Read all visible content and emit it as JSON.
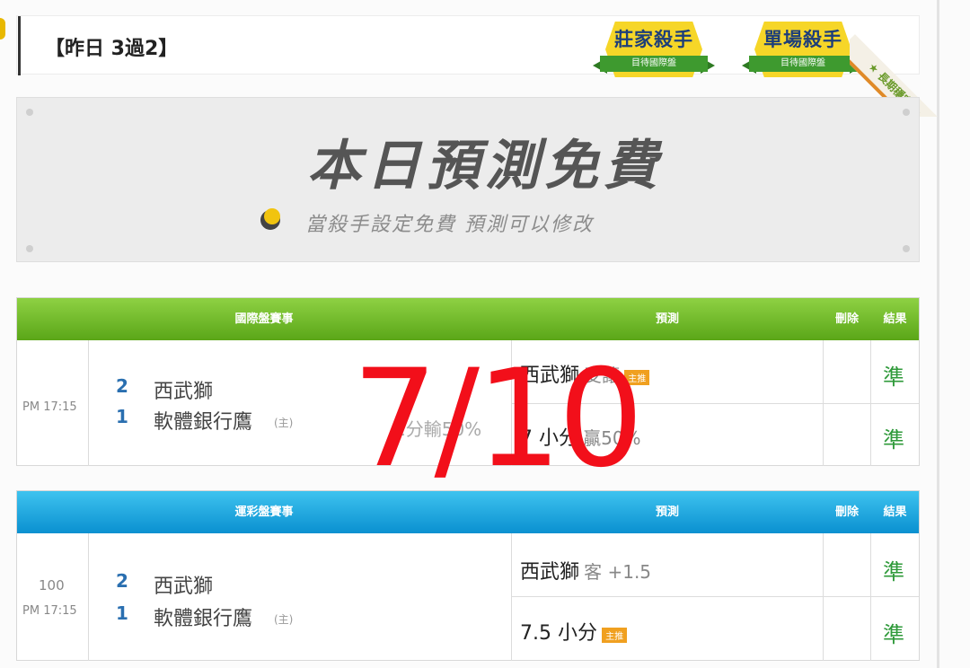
{
  "header": {
    "title": "【昨日 3過2】"
  },
  "badges": [
    {
      "title": "莊家殺手",
      "ribbon": "目待國際盤"
    },
    {
      "title": "單場殺手",
      "ribbon": "目待國際盤"
    }
  ],
  "corner_label": "★ 長期穩定 ★",
  "promo": {
    "title": "本日預測免費",
    "subtitle": "當殺手設定免費  預測可以修改"
  },
  "intl_table": {
    "headers": {
      "event": "國際盤賽事",
      "predict": "預測",
      "delete": "刪除",
      "result": "結果"
    },
    "time": "PM 17:15",
    "team1": {
      "score": "2",
      "name": "西武獅"
    },
    "team2": {
      "score": "1",
      "name": "軟體銀行鷹",
      "mark": "(主)"
    },
    "line_info": "1分輸50%",
    "pred1": {
      "main": "西武獅",
      "sub": "受讓",
      "tag": "主推"
    },
    "pred2": {
      "main": "7 小分",
      "sub": "贏50%"
    },
    "result1": "準",
    "result2": "準"
  },
  "lottery_table": {
    "headers": {
      "event": "運彩盤賽事",
      "predict": "預測",
      "delete": "刪除",
      "result": "結果"
    },
    "game_no": "100",
    "time": "PM 17:15",
    "team1": {
      "score": "2",
      "name": "西武獅"
    },
    "team2": {
      "score": "1",
      "name": "軟體銀行鷹",
      "mark": "(主)"
    },
    "pred1": {
      "main": "西武獅",
      "sub": "客 +1.5"
    },
    "pred2": {
      "main": "7.5 小分",
      "tag": "主推"
    },
    "result1": "準",
    "result2": "準"
  },
  "overlay_text": "7/10"
}
